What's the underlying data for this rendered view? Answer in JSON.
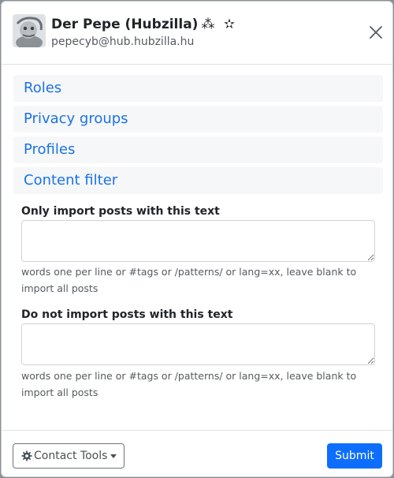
{
  "colors": {
    "accent": "#1a73e8",
    "primary_button": "#0d6efd",
    "accordion_bg": "#f6f7f8"
  },
  "header": {
    "avatar_icon": "avatar-image",
    "name": "Der Pepe (Hubzilla)",
    "symbols": "⁂ ✫",
    "address": "pepecyb@hub.hubzilla.hu",
    "close_icon": "close-icon"
  },
  "sections": [
    {
      "label": "Roles"
    },
    {
      "label": "Privacy groups"
    },
    {
      "label": "Profiles"
    },
    {
      "label": "Content filter"
    }
  ],
  "filters": {
    "include": {
      "label": "Only import posts with this text",
      "value": "",
      "help": "words one per line or #tags or /patterns/ or lang=xx, leave blank to import all posts"
    },
    "exclude": {
      "label": "Do not import posts with this text",
      "value": "",
      "help": "words one per line or #tags or /patterns/ or lang=xx, leave blank to import all posts"
    }
  },
  "footer": {
    "tools_label": "Contact Tools",
    "tools_icon": "gear-icon",
    "submit_label": "Submit"
  }
}
